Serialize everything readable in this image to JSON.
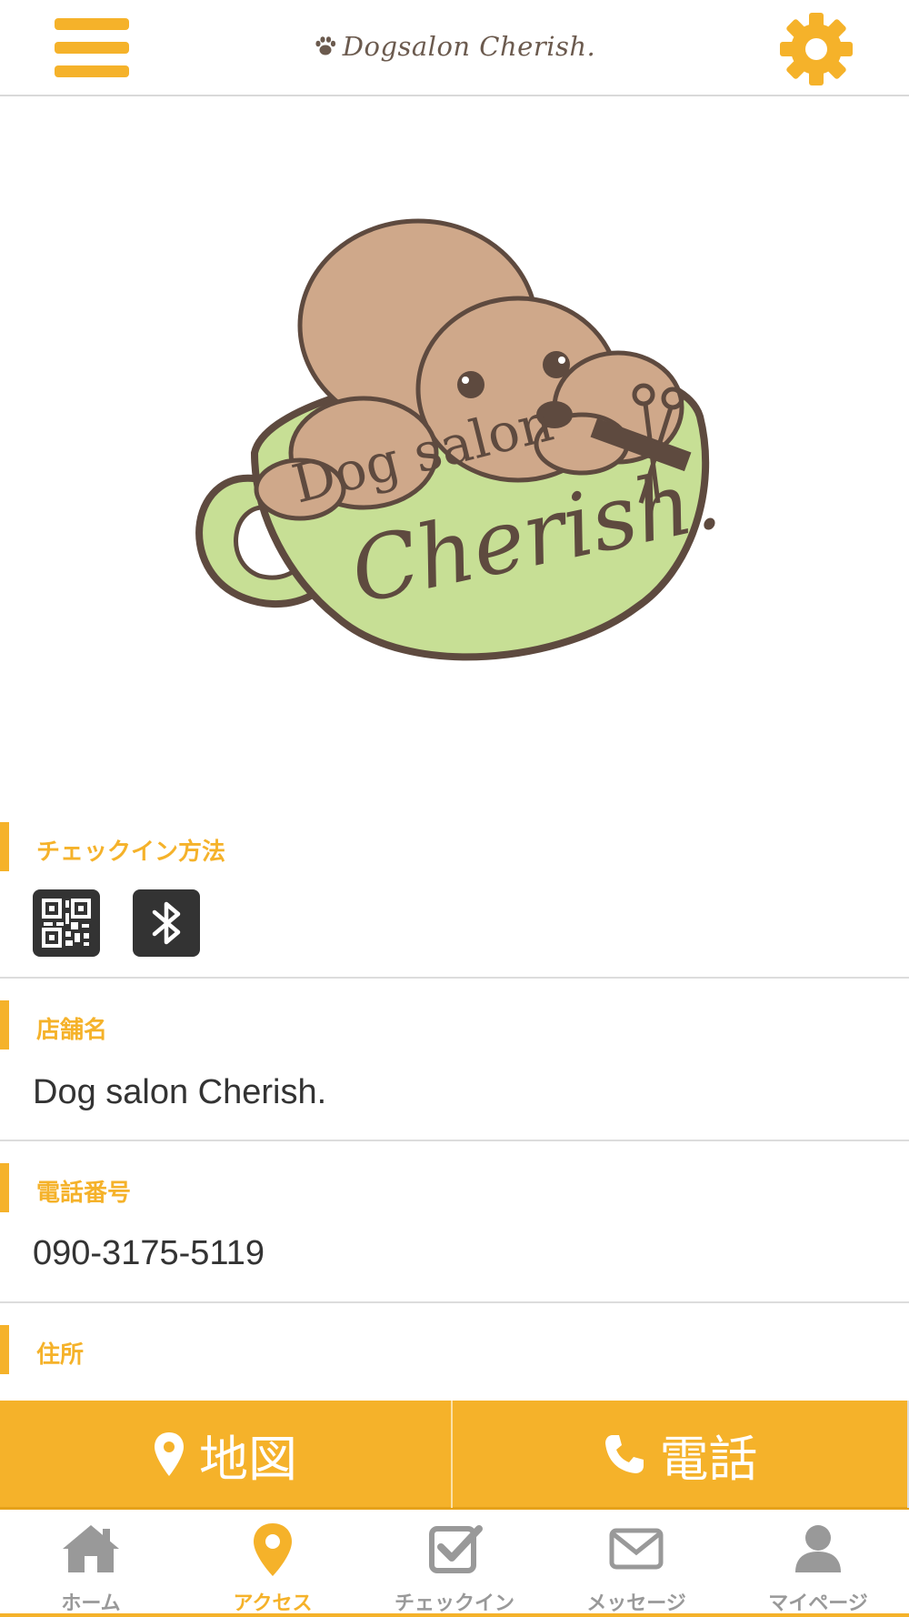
{
  "header": {
    "title": "Dogsalon Cherish.",
    "menu_icon": "hamburger-menu-icon",
    "settings_icon": "gear-icon"
  },
  "logo": {
    "line1": "Dog salon",
    "line2": "Cherish."
  },
  "sections": {
    "checkin": {
      "label": "チェックイン方法",
      "methods": [
        "qr-code-icon",
        "bluetooth-icon"
      ]
    },
    "shop_name": {
      "label": "店舗名",
      "value": "Dog salon Cherish."
    },
    "phone": {
      "label": "電話番号",
      "value": "090-3175-5119"
    },
    "address": {
      "label": "住所"
    }
  },
  "actions": {
    "map_label": "地図",
    "tel_label": "電話"
  },
  "tabs": [
    {
      "label": "ホーム",
      "icon": "home-icon",
      "active": false
    },
    {
      "label": "アクセス",
      "icon": "map-pin-icon",
      "active": true
    },
    {
      "label": "チェックイン",
      "icon": "checkbox-icon",
      "active": false
    },
    {
      "label": "メッセージ",
      "icon": "envelope-icon",
      "active": false
    },
    {
      "label": "マイページ",
      "icon": "user-icon",
      "active": false
    }
  ],
  "colors": {
    "accent": "#f5b22a",
    "text": "#333333",
    "tab_inactive": "#999999",
    "divider": "#dcdcdc"
  }
}
